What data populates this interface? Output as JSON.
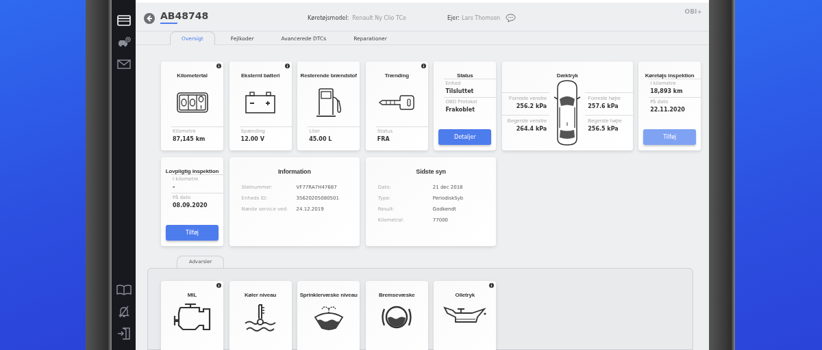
{
  "header": {
    "plate": "AB48748",
    "model_label": "Køretøjsmodel:",
    "model": "Renault Ny Clio TCe",
    "owner_label": "Ejer:",
    "owner": "Lars Thomsen",
    "logo": "OBI+"
  },
  "sidebar": {
    "top": [
      {
        "selected": true
      },
      {
        "selected": false
      },
      {
        "selected": false
      }
    ],
    "bottom": [
      {
        "selected": false
      },
      {
        "selected": false
      },
      {
        "selected": false
      }
    ]
  },
  "tabs": [
    {
      "label": "Oversigt",
      "selected": true
    },
    {
      "label": "Fejlkoder",
      "selected": false
    },
    {
      "label": "Avancerede DTCs",
      "selected": false
    },
    {
      "label": "Reparationer",
      "selected": false
    }
  ],
  "cards": [
    {
      "kind": "metric",
      "title": "Kilometertal",
      "info": true,
      "label": "Kilometre",
      "value": "87,145 km"
    },
    {
      "kind": "metric",
      "title": "Eksternt batteri",
      "info": true,
      "label": "Spænding",
      "value": "12.00 V"
    },
    {
      "kind": "metric",
      "title": "Resterende brændstof",
      "info": false,
      "label": "Liter",
      "value": "45.00 L"
    },
    {
      "kind": "metric",
      "title": "Trænding",
      "info": true,
      "label": "Status",
      "value": "FRA"
    },
    {
      "kind": "status",
      "title": "Status",
      "fields": [
        {
          "label": "Enhed",
          "value": "Tilsluttet"
        },
        {
          "label": "OBD Protokol",
          "value": "Frakoblet"
        }
      ],
      "button": {
        "label": "Detaljer",
        "disabled": false
      }
    },
    {
      "kind": "tires",
      "title": "Dæktryk",
      "tires": [
        {
          "label": "Forreste venstre",
          "value": "256.2 kPa"
        },
        {
          "label": "Forreste højre",
          "value": "257.6 kPa"
        },
        {
          "label": "Begerste venstre",
          "value": "264.4 kPa"
        },
        {
          "label": "Begerste højre",
          "value": "256.5 kPa"
        }
      ]
    },
    {
      "kind": "status",
      "title": "Køretøjs inspektion",
      "fields": [
        {
          "label": "I kilometre",
          "value": "18,893 km"
        },
        {
          "label": "På dato",
          "value": "22.11.2020"
        }
      ],
      "button": {
        "label": "Tilføj",
        "disabled": true
      }
    },
    {
      "kind": "status",
      "title": "Lovpligtig inspektion",
      "fields": [
        {
          "label": "I kilometre",
          "value": "-"
        },
        {
          "label": "På dato",
          "value": "08.09.2020"
        }
      ],
      "button": {
        "label": "Tilføj",
        "disabled": false
      }
    },
    {
      "kind": "table",
      "title": "Information",
      "rows": [
        {
          "label": "Stelnummer:",
          "value": "VF77RA7H47687"
        },
        {
          "label": "Enheds ID:",
          "value": "35620205080501"
        },
        {
          "label": "Næste service ved:",
          "value": "24.12.2019"
        }
      ]
    },
    {
      "kind": "table",
      "title": "Sidste syn",
      "rows": [
        {
          "label": "Dato:",
          "value": "21 dec 2018"
        },
        {
          "label": "Type:",
          "value": "PeriodiskSyb"
        },
        {
          "label": "Result:",
          "value": "Godkendt"
        },
        {
          "label": "Kilometral:",
          "value": "77000"
        }
      ]
    }
  ],
  "warnings": {
    "tab": "Advarsler",
    "cards": [
      {
        "title": "MIL",
        "info": true
      },
      {
        "title": "Køler niveau",
        "info": false
      },
      {
        "title": "Sprinklervæske niveau",
        "info": false
      },
      {
        "title": "Bremsevæske",
        "info": false
      },
      {
        "title": "Olietryk",
        "info": true
      }
    ]
  }
}
